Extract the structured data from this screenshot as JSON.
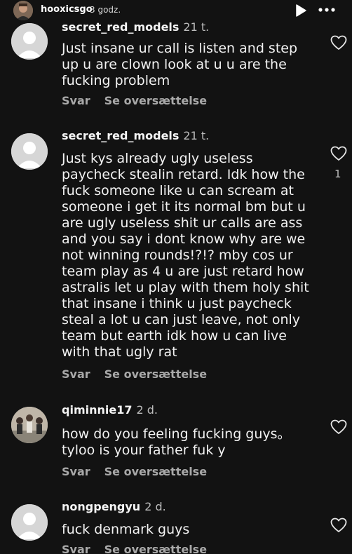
{
  "story": {
    "username": "hooxicsgo",
    "time": "3 godz.",
    "play_icon": "play-icon",
    "more_icon": "more-icon"
  },
  "comments": [
    {
      "username": "secret_red_models",
      "time": "21 t.",
      "text": "Just insane ur call is listen and step up u are clown look at u u are the fucking problem",
      "reply": "Svar",
      "translate": "Se oversættelse",
      "likes": ""
    },
    {
      "username": "secret_red_models",
      "time": "21 t.",
      "text": "Just kys already ugly useless paycheck stealin retard. Idk how the fuck someone like u can scream at someone i get it its normal bm but u are ugly useless shit ur calls are ass and you say i dont know why are we not winning rounds!?!? mby cos ur team play as 4 u are just retard how astralis let u play with them holy shit that insane i think u just paycheck steal a lot u can just leave, not only team but earth idk how u can live with that ugly rat",
      "reply": "Svar",
      "translate": "Se oversættelse",
      "likes": "1"
    },
    {
      "username": "qiminnie17",
      "time": "2 d.",
      "text": "how do you feeling fucking guys。 tyloo is your father fuk y",
      "reply": "Svar",
      "translate": "Se oversættelse",
      "likes": ""
    },
    {
      "username": "nongpengyu",
      "time": "2 d.",
      "text": "fuck denmark guys",
      "reply": "Svar",
      "translate": "Se oversættelse",
      "likes": ""
    }
  ],
  "colors": {
    "background": "#121212",
    "text": "#f2f2f2",
    "muted": "#a8a8a8",
    "default_avatar": "#d6d6d6"
  }
}
